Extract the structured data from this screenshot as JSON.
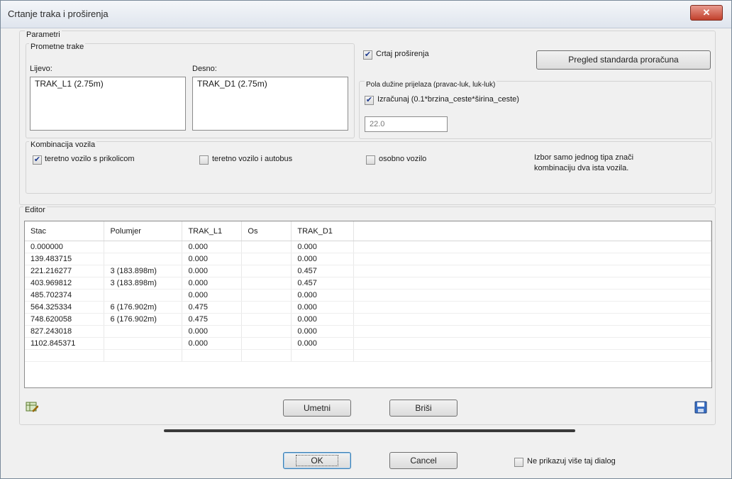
{
  "window": {
    "title": "Crtanje traka i proširenja",
    "close_glyph": "✕"
  },
  "parametri": {
    "group_label": "Parametri",
    "prometne_trake": {
      "label": "Prometne trake",
      "left_label": "Lijevo:",
      "left_items": [
        "TRAK_L1 (2.75m)"
      ],
      "right_label": "Desno:",
      "right_items": [
        "TRAK_D1 (2.75m)"
      ]
    },
    "crtaj_prosirenja": {
      "label": "Crtaj proširenja",
      "checked": true
    },
    "pregled_button": "Pregled standarda proračuna",
    "pola_duzine": {
      "label": "Pola dužine prijelaza (pravac-luk, luk-luk)",
      "izracunaj_label": "Izračunaj (0.1*brzina_ceste*širina_ceste)",
      "izracunaj_checked": true,
      "value": "22.0"
    },
    "kombinacija": {
      "label": "Kombinacija vozila",
      "options": [
        {
          "label": "teretno vozilo s prikolicom",
          "checked": true
        },
        {
          "label": "teretno vozilo i autobus",
          "checked": false
        },
        {
          "label": "osobno vozilo",
          "checked": false
        }
      ],
      "note_line1": "Izbor samo jednog tipa znači",
      "note_line2": "kombinaciju dva ista vozila."
    }
  },
  "editor": {
    "group_label": "Editor",
    "columns": [
      "Stac",
      "Polumjer",
      "TRAK_L1",
      "Os",
      "TRAK_D1"
    ],
    "rows": [
      [
        "0.000000",
        "",
        "0.000",
        "",
        "0.000"
      ],
      [
        "139.483715",
        "",
        "0.000",
        "",
        "0.000"
      ],
      [
        "221.216277",
        "3 (183.898m)",
        "0.000",
        "",
        "0.457"
      ],
      [
        "403.969812",
        "3 (183.898m)",
        "0.000",
        "",
        "0.457"
      ],
      [
        "485.702374",
        "",
        "0.000",
        "",
        "0.000"
      ],
      [
        "564.325334",
        "6 (176.902m)",
        "0.475",
        "",
        "0.000"
      ],
      [
        "748.620058",
        "6 (176.902m)",
        "0.475",
        "",
        "0.000"
      ],
      [
        "827.243018",
        "",
        "0.000",
        "",
        "0.000"
      ],
      [
        "1102.845371",
        "",
        "0.000",
        "",
        "0.000"
      ]
    ],
    "umetni_button": "Umetni",
    "brisi_button": "Briši",
    "left_icon": "edit-table-icon",
    "right_icon": "save-icon"
  },
  "footer": {
    "ok_button": "OK",
    "cancel_button": "Cancel",
    "ne_prikazuj_label": "Ne prikazuj više taj dialog",
    "ne_prikazuj_checked": false
  },
  "colors": {
    "title_bg": "#dfe5ee",
    "close_red": "#c1402c",
    "accent_blue": "#2b66c9"
  }
}
